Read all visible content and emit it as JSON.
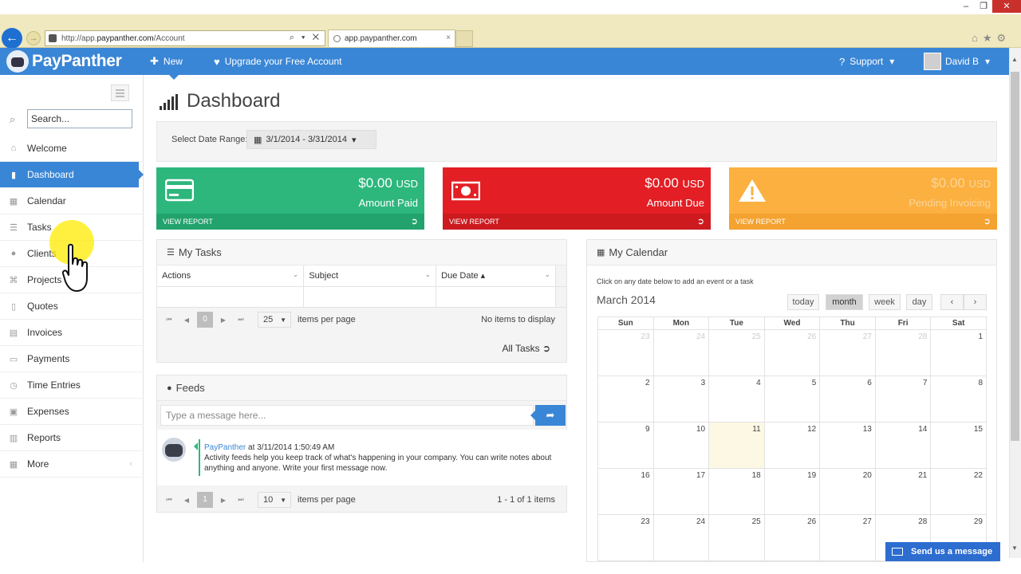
{
  "browser": {
    "url_prefix": "http://app.",
    "url_host": "paypanther.com",
    "url_path": "/Account",
    "url_controls": "⌕ ▾ ✕",
    "tab_title": "app.paypanther.com",
    "tab_close": "×",
    "win_min": "–",
    "win_max": "❐",
    "win_close": "✕",
    "tool_icons": "⌂★⚙"
  },
  "navbar": {
    "logo": "PayPanther",
    "new_label": "New",
    "new_caret": "▾",
    "upgrade_label": "Upgrade your Free Account",
    "support_label": "Support",
    "user_name": "David B",
    "caret": "▾"
  },
  "sidebar": {
    "search_placeholder": "Search...",
    "items": [
      {
        "label": "Welcome",
        "icon": "home-icon",
        "glyph": "⌂"
      },
      {
        "label": "Dashboard",
        "icon": "bars-icon",
        "glyph": "▮"
      },
      {
        "label": "Calendar",
        "icon": "calendar-icon",
        "glyph": "▦"
      },
      {
        "label": "Tasks",
        "icon": "list-icon",
        "glyph": "☰"
      },
      {
        "label": "Clients",
        "icon": "users-icon",
        "glyph": "●"
      },
      {
        "label": "Projects",
        "icon": "sitemap-icon",
        "glyph": "⌘"
      },
      {
        "label": "Quotes",
        "icon": "file-icon",
        "glyph": "▯"
      },
      {
        "label": "Invoices",
        "icon": "file-text-icon",
        "glyph": "▤"
      },
      {
        "label": "Payments",
        "icon": "credit-card-icon",
        "glyph": "▭"
      },
      {
        "label": "Time Entries",
        "icon": "clock-icon",
        "glyph": "◷"
      },
      {
        "label": "Expenses",
        "icon": "money-icon",
        "glyph": "▣"
      },
      {
        "label": "Reports",
        "icon": "chart-icon",
        "glyph": "▥"
      },
      {
        "label": "More",
        "icon": "grid-icon",
        "glyph": "▦",
        "arrow": "‹"
      }
    ]
  },
  "main": {
    "title": "Dashboard",
    "range_label": "Select Date Range:",
    "range_value": "3/1/2014 - 3/31/2014",
    "range_caret": "▾",
    "cards": [
      {
        "amount": "$0.00",
        "currency": "USD",
        "label": "Amount Paid",
        "link": "VIEW REPORT",
        "color": "#2db77d"
      },
      {
        "amount": "$0.00",
        "currency": "USD",
        "label": "Amount Due",
        "link": "VIEW REPORT",
        "color": "#e31e24"
      },
      {
        "amount": "$0.00",
        "currency": "USD",
        "label": "Pending Invoicing",
        "link": "VIEW REPORT",
        "color": "#fbb040"
      }
    ]
  },
  "tasks": {
    "title": "My Tasks",
    "columns": [
      "Actions",
      "Subject",
      "Due Date ▴"
    ],
    "caret": "⌄",
    "pager": {
      "current": "0",
      "page_size": "25",
      "items_label": "items per page",
      "info": "No items to display"
    },
    "all_link": "All Tasks ➲"
  },
  "feeds": {
    "title": "Feeds",
    "placeholder": "Type a message here...",
    "send_glyph": "➦",
    "item": {
      "author": "PayPanther",
      "meta": " at 3/11/2014 1:50:49 AM",
      "text": "Activity feeds help you keep track of what's happening in your company. You can write notes about anything and anyone. Write your first message now."
    },
    "pager": {
      "current": "1",
      "page_size": "10",
      "items_label": "items per page",
      "info": "1 - 1 of 1 items"
    }
  },
  "pager_glyphs": {
    "first": "⏮",
    "prev": "◀",
    "next": "▶",
    "last": "⏭",
    "caret": "▼"
  },
  "calendar": {
    "title": "My Calendar",
    "hint": "Click on any date below to add an event or a task",
    "month": "March 2014",
    "buttons": {
      "today": "today",
      "month": "month",
      "week": "week",
      "day": "day",
      "prev": "‹",
      "next": "›"
    },
    "weekdays": [
      "Sun",
      "Mon",
      "Tue",
      "Wed",
      "Thu",
      "Fri",
      "Sat"
    ],
    "weeks": [
      [
        "23",
        "24",
        "25",
        "26",
        "27",
        "28",
        "1"
      ],
      [
        "2",
        "3",
        "4",
        "5",
        "6",
        "7",
        "8"
      ],
      [
        "9",
        "10",
        "11",
        "12",
        "13",
        "14",
        "15"
      ],
      [
        "16",
        "17",
        "18",
        "19",
        "20",
        "21",
        "22"
      ],
      [
        "23",
        "24",
        "25",
        "26",
        "27",
        "28",
        "29"
      ]
    ],
    "today_date": "11",
    "today_color": "#fcf8e3"
  },
  "widget": {
    "send_message": "Send us a message"
  },
  "scroll": {
    "up": "▲",
    "down": "▼"
  }
}
